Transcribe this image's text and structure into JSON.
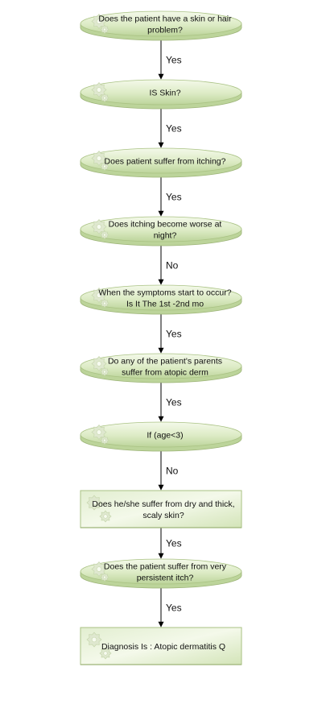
{
  "flowchart": {
    "nodes": [
      {
        "shape": "disc",
        "lines": [
          "Does the patient have a skin or hair",
          "problem?"
        ]
      },
      {
        "shape": "disc",
        "lines": [
          "IS Skin?"
        ]
      },
      {
        "shape": "disc",
        "lines": [
          "Does patient suffer from itching?"
        ]
      },
      {
        "shape": "disc",
        "lines": [
          "Does itching become worse at",
          "night?"
        ]
      },
      {
        "shape": "disc",
        "lines": [
          "When the symptoms start to occur?",
          "Is It The 1st -2nd mo"
        ]
      },
      {
        "shape": "disc",
        "lines": [
          "Do any of the patient's parents",
          "suffer from atopic derm"
        ]
      },
      {
        "shape": "disc",
        "lines": [
          "If (age<3)"
        ]
      },
      {
        "shape": "rect",
        "lines": [
          "Does he/she suffer from dry and thick,",
          "scaly skin?"
        ]
      },
      {
        "shape": "disc",
        "lines": [
          "Does the patient suffer from very",
          "persistent itch?"
        ]
      },
      {
        "shape": "rect",
        "lines": [
          "Diagnosis Is : Atopic dermatitis Q"
        ]
      }
    ],
    "edges": [
      "Yes",
      "Yes",
      "Yes",
      "No",
      "Yes",
      "Yes",
      "No",
      "Yes",
      "Yes"
    ],
    "colors": {
      "fill_light": "#f2f8e6",
      "fill_dark": "#bcd49a",
      "stroke": "#a9c283",
      "gear": "#dfe8cf",
      "arrow": "#000000"
    },
    "icon": "gear-icon"
  }
}
